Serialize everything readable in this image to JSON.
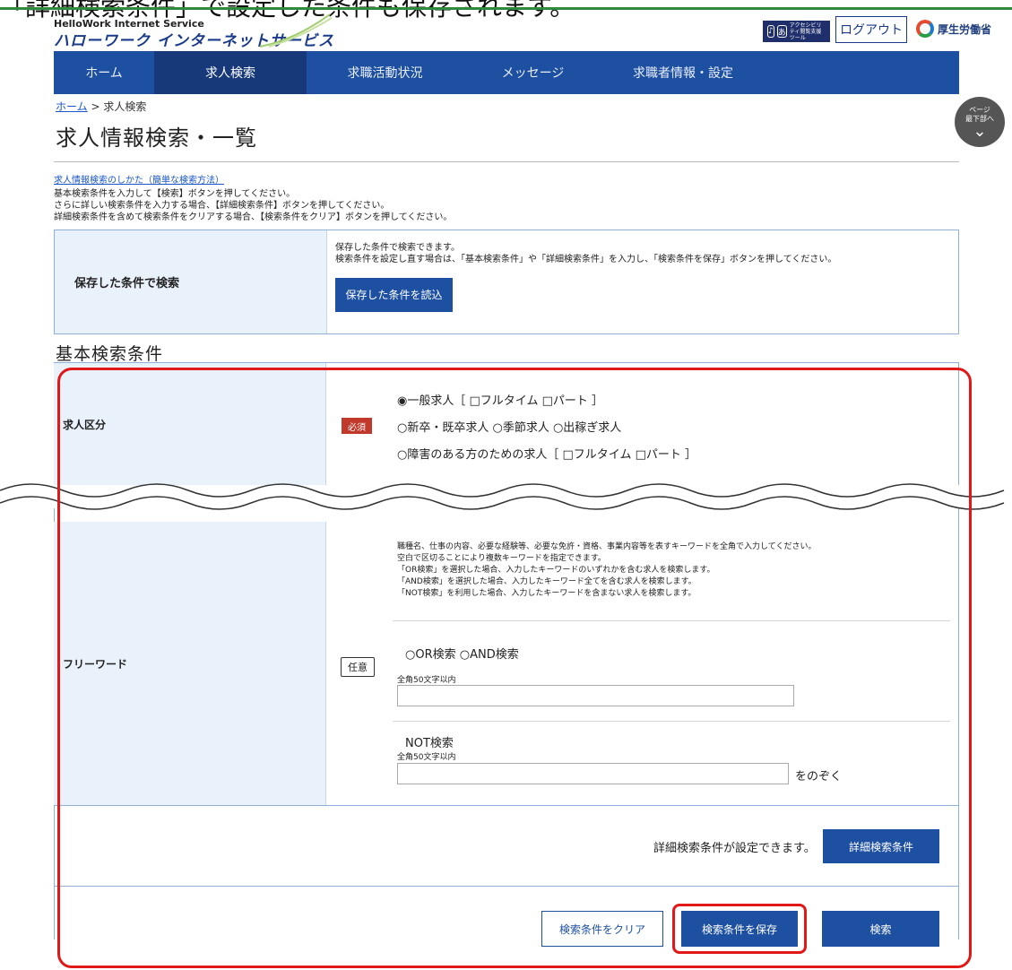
{
  "caption": "「詳細検索条件」で設定した条件も保存されます。",
  "brand": {
    "en": "HelloWork Internet Service",
    "ja": "ハローワーク インターネットサービス"
  },
  "header": {
    "access_tool": "アクセシビリティ閲覧支援ツール",
    "logout": "ログアウト",
    "ministry": "厚生労働省"
  },
  "nav": [
    "ホーム",
    "求人検索",
    "求職活動状況",
    "メッセージ",
    "求職者情報・設定"
  ],
  "breadcrumb": {
    "home": "ホーム",
    "sep": " > ",
    "current": "求人検索"
  },
  "page_title": "求人情報検索・一覧",
  "jump": {
    "line1": "ページ",
    "line2": "最下部へ"
  },
  "howto_link": "求人情報検索のしかた（簡単な検索方法）",
  "guide": [
    "基本検索条件を入力して【検索】ボタンを押してください。",
    "さらに詳しい検索条件を入力する場合、【詳細検索条件】ボタンを押してください。",
    "詳細検索条件を含めて検索条件をクリアする場合、【検索条件をクリア】ボタンを押してください。"
  ],
  "saved": {
    "label": "保存した条件で検索",
    "desc1": "保存した条件で検索できます。",
    "desc2": "検索条件を設定し直す場合は、「基本検索条件」や「詳細検索条件」を入力し、「検索条件を保存」ボタンを押してください。",
    "load_btn": "保存した条件を読込"
  },
  "section_title": "基本検索条件",
  "kyujin": {
    "label": "求人区分",
    "badge": "必須",
    "line1": "◉一般求人［ □フルタイム □パート ］",
    "line2": "○新卒・既卒求人 ○季節求人 ○出稼ぎ求人",
    "line3": "○障害のある方のための求人［ □フルタイム □パート ］"
  },
  "freeword": {
    "label": "フリーワード",
    "badge": "任意",
    "help": [
      "職種名、仕事の内容、必要な経験等、必要な免許・資格、事業内容等を表すキーワードを全角で入力してください。",
      "空白で区切ることにより複数キーワードを指定できます。",
      "「OR検索」を選択した場合、入力したキーワードのいずれかを含む求人を検索します。",
      "「AND検索」を選択した場合、入力したキーワード全てを含む求人を検索します。",
      "「NOT検索」を利用した場合、入力したキーワードを含まない求人を検索します。"
    ],
    "or_and": "○OR検索 ○AND検索",
    "limit": "全角50文字以内",
    "not_title": "NOT検索",
    "not_limit": "全角50文字以内",
    "exclude": "をのぞく"
  },
  "detail": {
    "text": "詳細検索条件が設定できます。",
    "btn": "詳細検索条件"
  },
  "actions": {
    "clear": "検索条件をクリア",
    "save": "検索条件を保存",
    "search": "検索"
  },
  "colors": {
    "nav": "#1e50a2",
    "highlight": "#e01818",
    "label_bg": "#e9f1fb"
  }
}
